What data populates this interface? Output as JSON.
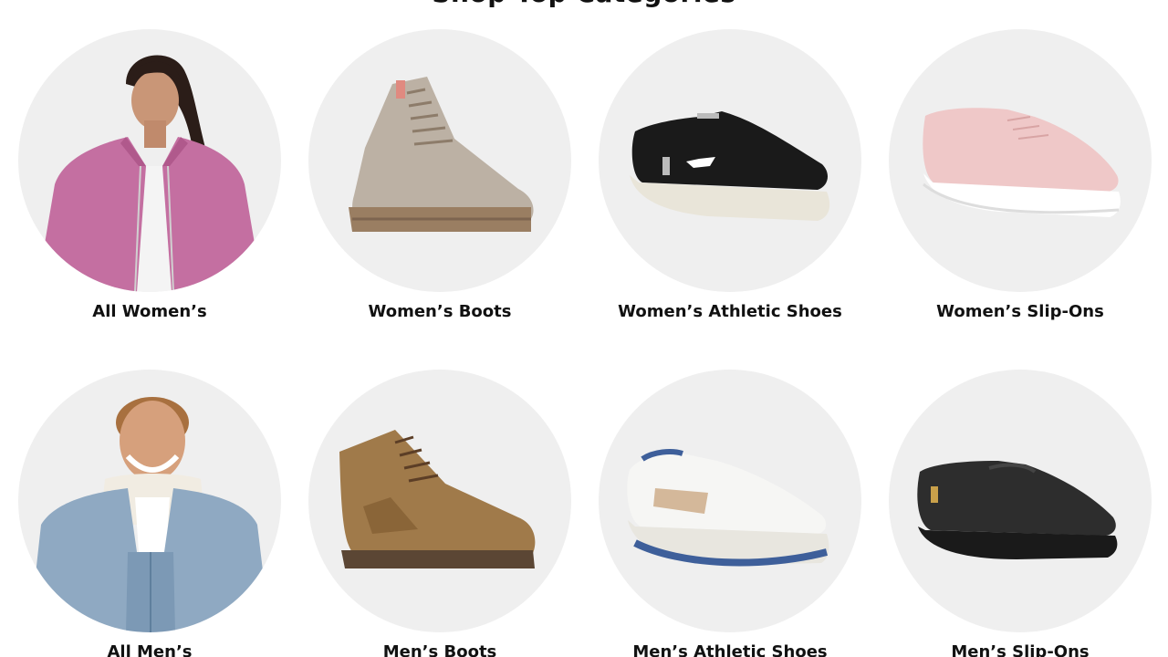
{
  "section": {
    "heading": "Shop Top Categories"
  },
  "categories": [
    {
      "label": "All Women’s",
      "image": "woman-pink-fleece-jacket-photo"
    },
    {
      "label": "Women’s Boots",
      "image": "taupe-suede-lace-up-boot-photo"
    },
    {
      "label": "Women’s Athletic Shoes",
      "image": "black-knit-athletic-sneaker-photo"
    },
    {
      "label": "Women’s Slip-Ons",
      "image": "pink-canvas-slip-on-photo"
    },
    {
      "label": "All Men’s",
      "image": "man-denim-sherpa-jacket-photo"
    },
    {
      "label": "Men’s Boots",
      "image": "brown-suede-high-top-boot-photo"
    },
    {
      "label": "Men’s Athletic Shoes",
      "image": "white-hoka-running-shoe-photo"
    },
    {
      "label": "Men’s Slip-Ons",
      "image": "black-knit-slip-on-shoe-photo"
    }
  ],
  "colors": {
    "circle_background": "#efefef",
    "text": "#111111"
  }
}
